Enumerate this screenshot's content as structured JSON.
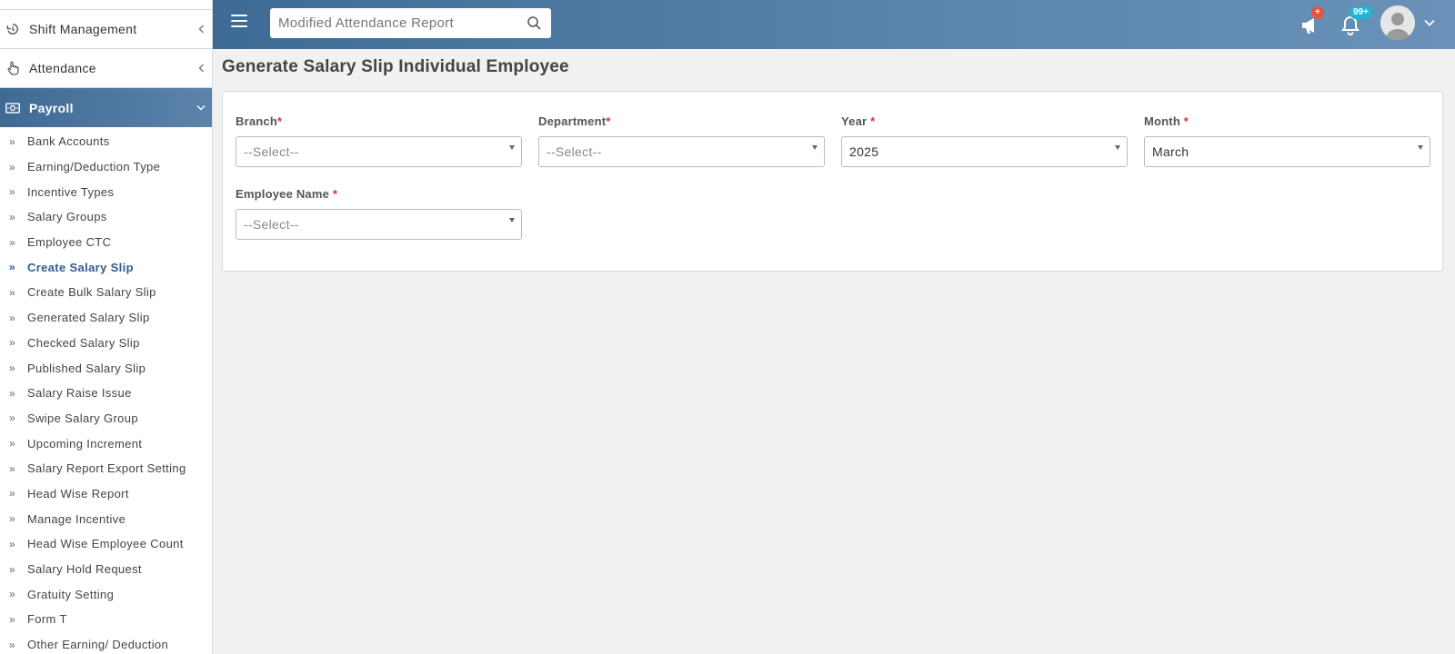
{
  "sidebar": {
    "groups": [
      {
        "label": "Shift Management",
        "icon": "history-icon"
      },
      {
        "label": "Attendance",
        "icon": "hand-pointer-icon"
      },
      {
        "label": "Payroll",
        "icon": "money-bill-icon"
      }
    ],
    "payroll_items": [
      "Bank Accounts",
      "Earning/Deduction Type",
      "Incentive Types",
      "Salary Groups",
      "Employee CTC",
      "Create Salary Slip",
      "Create Bulk Salary Slip",
      "Generated Salary Slip",
      "Checked Salary Slip",
      "Published Salary Slip",
      "Salary Raise Issue",
      "Swipe Salary Group",
      "Upcoming Increment",
      "Salary Report Export Setting",
      "Head Wise Report",
      "Manage Incentive",
      "Head Wise Employee Count",
      "Salary Hold Request",
      "Gratuity Setting",
      "Form T",
      "Other Earning/ Deduction"
    ],
    "active_group": "Payroll",
    "current_item": "Create Salary Slip"
  },
  "topbar": {
    "search_placeholder": "Modified Attendance Report",
    "announcement_badge": "+",
    "notification_badge": "99+",
    "colors": {
      "announcement_badge": "#e8533f",
      "notification_badge": "#1fb5d6"
    }
  },
  "page": {
    "title": "Generate Salary Slip Individual Employee"
  },
  "form": {
    "branch": {
      "label": "Branch",
      "required": "*",
      "value": "--Select--"
    },
    "department": {
      "label": "Department",
      "required": "*",
      "value": "--Select--"
    },
    "year": {
      "label": "Year",
      "required": "*",
      "value": "2025"
    },
    "month": {
      "label": "Month",
      "required": "*",
      "value": "March"
    },
    "employee_name": {
      "label": "Employee Name",
      "required": "*",
      "value": "--Select--"
    }
  }
}
